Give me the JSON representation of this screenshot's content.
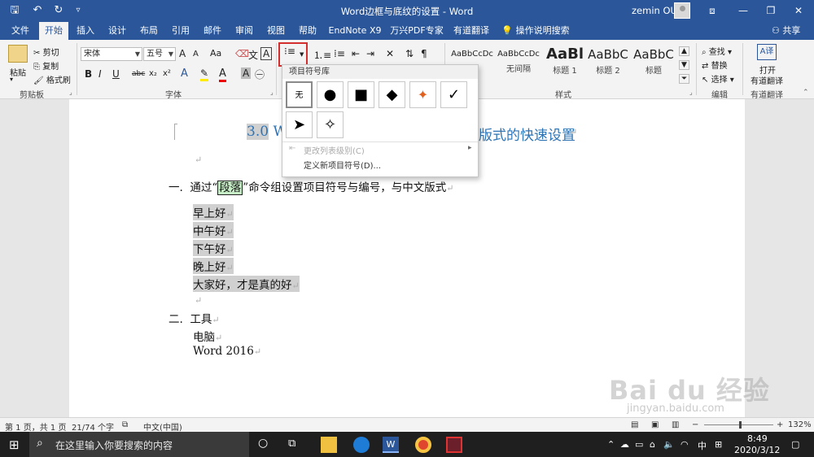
{
  "window": {
    "title": "Word边框与底纹的设置 - Word",
    "user": "zemin OU"
  },
  "tabs": [
    "文件",
    "开始",
    "插入",
    "设计",
    "布局",
    "引用",
    "邮件",
    "审阅",
    "视图",
    "帮助",
    "EndNote X9",
    "万兴PDF专家",
    "有道翻译",
    "操作说明搜索"
  ],
  "share_label": "共享",
  "ribbon": {
    "clipboard": {
      "paste": "粘贴",
      "cut": "剪切",
      "copy": "复制",
      "format_painter": "格式刷",
      "group": "剪贴板"
    },
    "font": {
      "font_name": "宋体",
      "font_size": "五号",
      "grow": "A",
      "shrink": "A",
      "case": "Aa",
      "bold": "B",
      "italic": "I",
      "underline": "U",
      "strike": "abc",
      "sub": "x₂",
      "sup": "x²",
      "color_a": "A",
      "group": "字体"
    },
    "styles": {
      "items": [
        {
          "sample": "AaBbCcDc",
          "name": ""
        },
        {
          "sample": "AaBbCcDc",
          "name": "无间隔"
        },
        {
          "sample": "AaBl",
          "name": "标题 1"
        },
        {
          "sample": "AaBbC",
          "name": "标题 2"
        },
        {
          "sample": "AaBbC",
          "name": "标题"
        }
      ],
      "group": "样式"
    },
    "editing": {
      "find": "查找",
      "replace": "替换",
      "select": "选择",
      "group": "编辑"
    },
    "translate": {
      "open": "打开",
      "label": "有道翻译",
      "group": "有道翻译"
    }
  },
  "bullet_library": {
    "title": "项目符号库",
    "none_label": "无",
    "symbols": [
      "●",
      "■",
      "◆",
      "✦",
      "✓",
      "➤",
      "✧"
    ],
    "change_level": "更改列表级别(C)",
    "define_new": "定义新项目符号(D)..."
  },
  "document": {
    "heading_num": "3.0",
    "heading_letter": "W",
    "heading_tail": "版式的快速设置",
    "line1_num": "一.",
    "line1_a": "通过“",
    "line1_word": "段落",
    "line1_b": "”命令组设置项目符号与编号，与中文版式",
    "list1": [
      "早上好",
      "中午好",
      "下午好",
      "晚上好",
      "大家好，才是真的好"
    ],
    "line2_num": "二.",
    "line2": "工具",
    "sub": [
      "电脑",
      "Word 2016"
    ],
    "para_mark": "↵"
  },
  "status": {
    "page": "第 1 页，共 1 页",
    "words": "21/74 个字",
    "lang": "中文(中国)",
    "zoom": "132%"
  },
  "taskbar": {
    "search_placeholder": "在这里输入你要搜索的内容",
    "ime": "中",
    "time": "8:49",
    "date": "2020/3/12"
  },
  "watermark": {
    "main": "Bai du 经验",
    "sub": "jingyan.baidu.com"
  },
  "colors": {
    "word_blue": "#2b579a",
    "heading_blue": "#2e74b5",
    "highlight_red": "#d32f2f"
  }
}
